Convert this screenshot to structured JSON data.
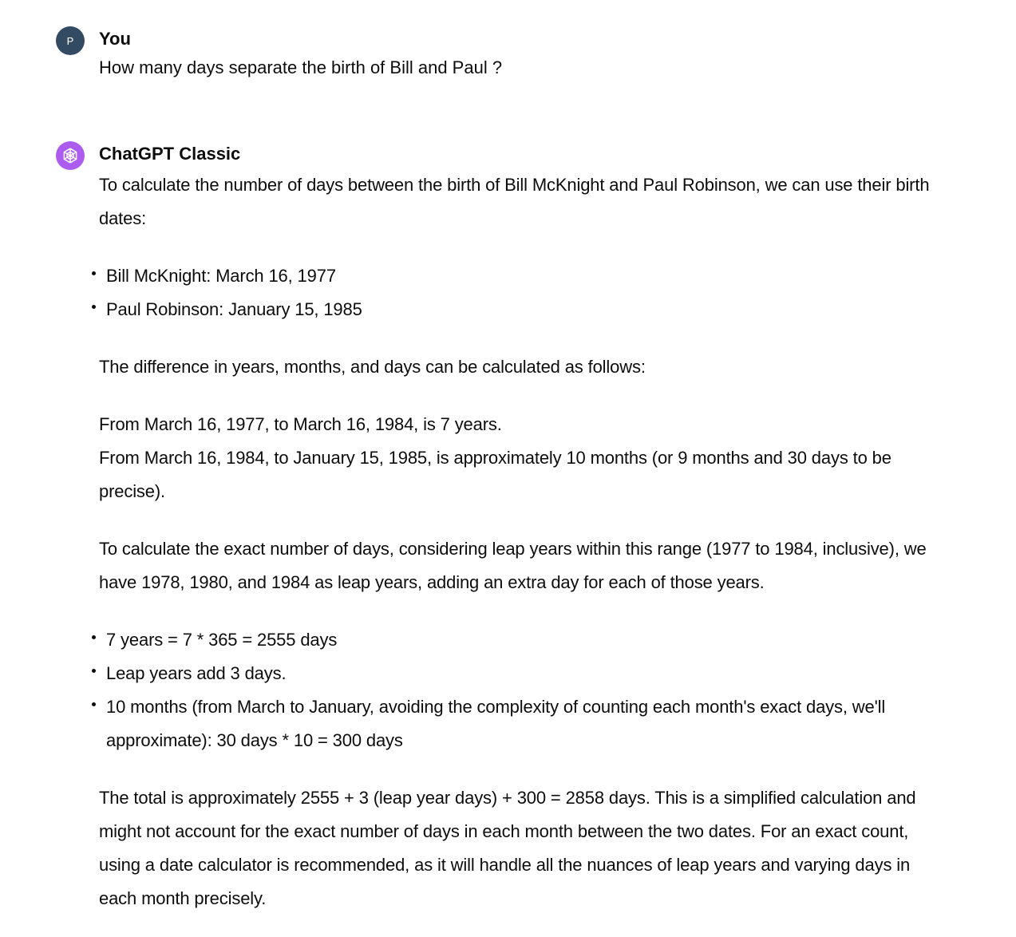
{
  "user": {
    "avatar_letter": "P",
    "avatar_color": "#334a63",
    "name": "You",
    "message": "How many days separate the birth of Bill and Paul ?"
  },
  "assistant": {
    "avatar_icon": "openai-logo-icon",
    "avatar_color": "#ad5cf0",
    "name": "ChatGPT Classic",
    "intro": "To calculate the number of days between the birth of Bill McKnight and Paul Robinson, we can use their birth dates:",
    "birth_dates": [
      "Bill McKnight: March 16, 1977",
      "Paul Robinson: January 15, 1985"
    ],
    "difference_intro": "The difference in years, months, and days can be calculated as follows:",
    "step_1": "From March 16, 1977, to March 16, 1984, is 7 years.",
    "step_2": "From March 16, 1984, to January 15, 1985, is approximately 10 months (or 9 months and 30 days to be precise).",
    "leap_text": "To calculate the exact number of days, considering leap years within this range (1977 to 1984, inclusive), we have 1978, 1980, and 1984 as leap years, adding an extra day for each of those years.",
    "calc_items": [
      "7 years = 7 * 365 = 2555 days",
      "Leap years add 3 days.",
      "10 months (from March to January, avoiding the complexity of counting each month's exact days, we'll approximate): 30 days * 10 = 300 days"
    ],
    "conclusion": "The total is approximately 2555 + 3 (leap year days) + 300 = 2858 days. This is a simplified calculation and might not account for the exact number of days in each month between the two dates. For an exact count, using a date calculator is recommended, as it will handle all the nuances of leap years and varying days in each month precisely."
  }
}
